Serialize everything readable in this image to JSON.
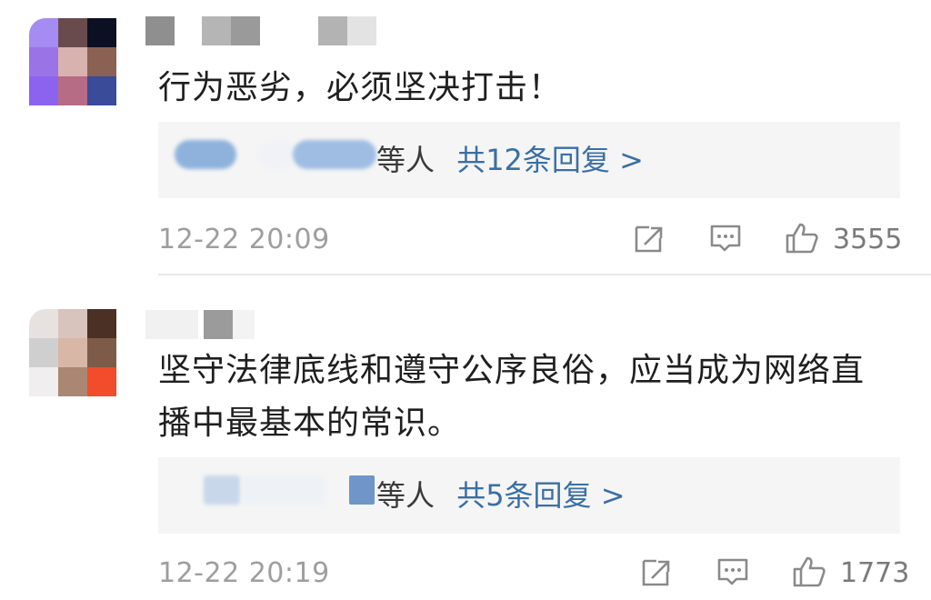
{
  "comments": [
    {
      "text_lines": [
        "行为恶劣，必须坚决打击！"
      ],
      "reply_who": "等人",
      "reply_count": "共12条回复 >",
      "time": "12-22 20:09",
      "likes": "3555",
      "avatar_colors": [
        "#a58cf2",
        "#6a4b4d",
        "#0d1022",
        "#9a74e6",
        "#d8b2af",
        "#8a6152",
        "#8b63ee",
        "#b66c84",
        "#3a4b9a"
      ]
    },
    {
      "text_lines": [
        "坚守法律底线和遵守公序良俗，应当成为网络直",
        "播中最基本的常识。"
      ],
      "reply_who": "等人",
      "reply_count": "共5条回复 >",
      "time": "12-22 20:19",
      "likes": "1773",
      "avatar_colors": [
        "#e7e2e0",
        "#d9c3bd",
        "#4a3025",
        "#cfcfcf",
        "#d8b7a6",
        "#7e5a49",
        "#f0eeee",
        "#a98772",
        "#f14c2c"
      ]
    }
  ],
  "colors": {
    "reply_accent": "#3a6fa5",
    "timestamp": "#9e9e9e",
    "reply_box_bg": "#f5f5f5"
  },
  "icons": [
    "share-icon",
    "comment-icon",
    "like-icon"
  ]
}
